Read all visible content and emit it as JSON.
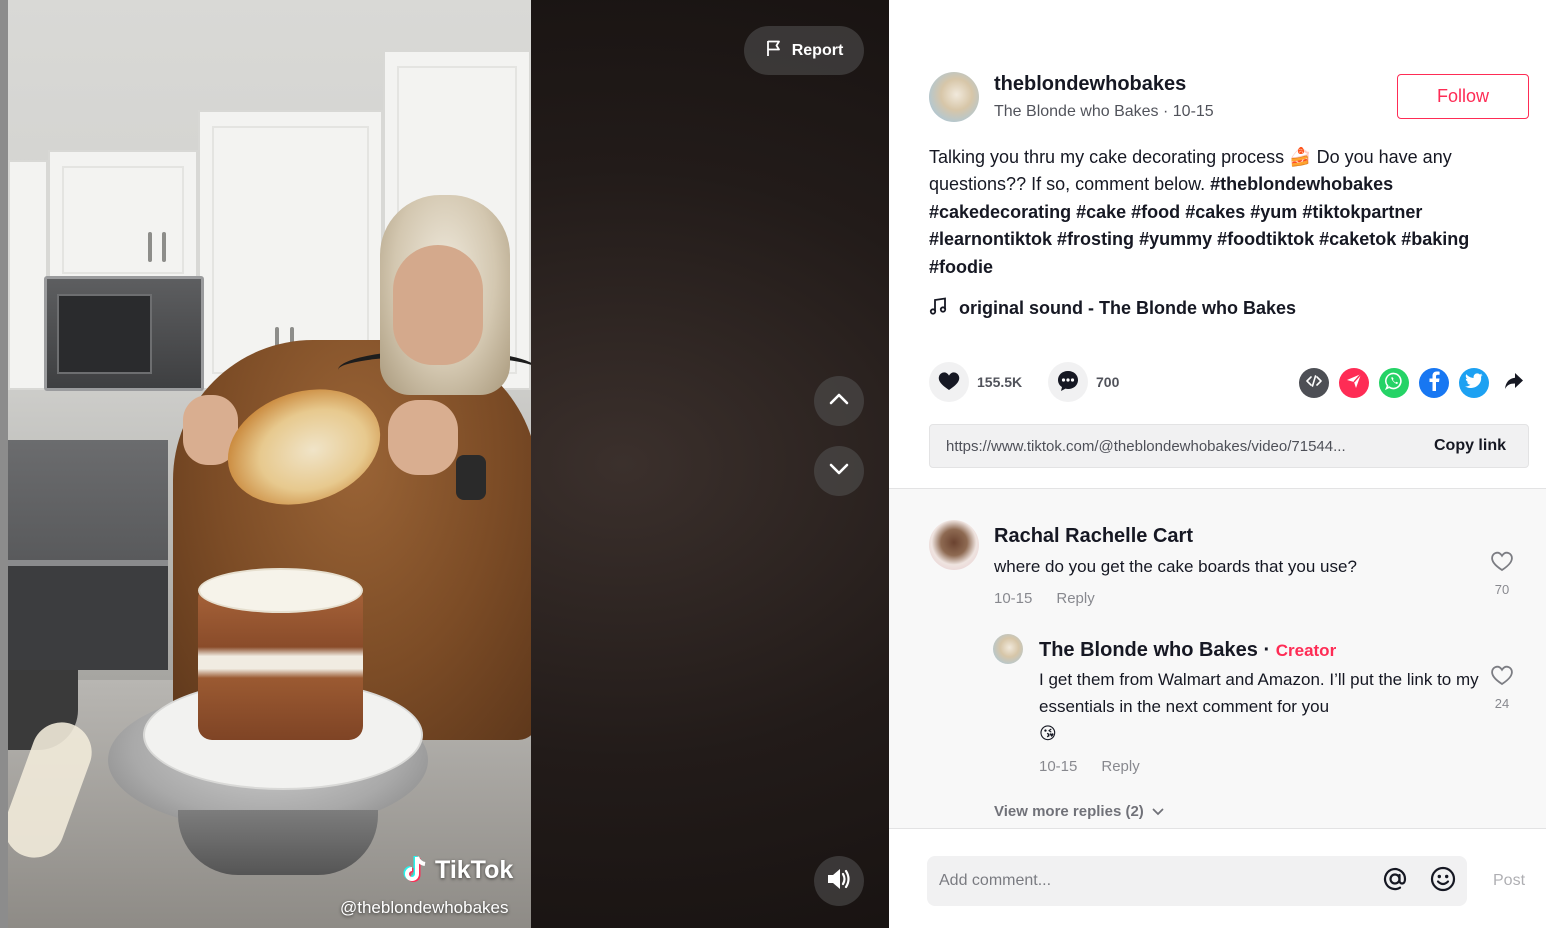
{
  "video": {
    "watermark_brand": "TikTok",
    "watermark_handle": "@theblondewhobakes",
    "report_label": "Report"
  },
  "author": {
    "handle": "theblondewhobakes",
    "subtitle": "The Blonde who Bakes · 10-15",
    "follow_label": "Follow"
  },
  "description": {
    "text_a": "Talking you thru my cake decorating process ",
    "emoji": "🍰",
    "text_b": " Do you have any questions?? If so, comment below. ",
    "hashtags": [
      "#theblondewhobakes",
      "#cakedecorating",
      "#cake",
      "#food",
      "#cakes",
      "#yum",
      "#tiktokpartner",
      "#learnontiktok",
      "#frosting",
      "#yummy",
      "#foodtiktok",
      "#caketok",
      "#baking",
      "#foodie"
    ]
  },
  "music": {
    "label": "original sound - The Blonde who Bakes"
  },
  "stats": {
    "likes": "155.5K",
    "comments": "700"
  },
  "share_icons": [
    "embed-icon",
    "send-icon",
    "whatsapp-icon",
    "facebook-icon",
    "twitter-icon",
    "share-arrow-icon"
  ],
  "link": {
    "url": "https://www.tiktok.com/@theblondewhobakes/video/71544...",
    "copy_label": "Copy link"
  },
  "comments": [
    {
      "name": "Rachal Rachelle Cart",
      "text": "where do you get the cake boards that you use?",
      "date": "10-15",
      "reply_label": "Reply",
      "likes": "70"
    },
    {
      "name": "The Blonde who Bakes",
      "separator": " · ",
      "badge": "Creator",
      "text": "I get them from Walmart and Amazon. I’ll put the link to my essentials in the next comment for you",
      "emoji": "😘",
      "date": "10-15",
      "reply_label": "Reply",
      "likes": "24"
    }
  ],
  "view_more_replies": "View more replies (2)",
  "comment_box": {
    "placeholder": "Add comment...",
    "post_label": "Post"
  },
  "colors": {
    "accent": "#fe2c55",
    "text": "#161823",
    "muted": "rgba(22,24,35,.75)"
  }
}
